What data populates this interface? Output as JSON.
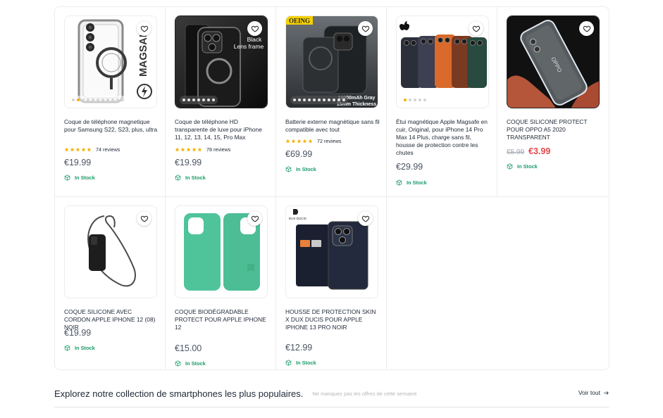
{
  "products": [
    {
      "title": "Coque de téléphone magnetique pour Samsung S22, S23, plus, ultra",
      "rating": 5,
      "reviews": "74 reviews",
      "price": "€19.99",
      "stock": "In Stock",
      "image_text": "MAGSAI",
      "dots": 11,
      "active_dot": 1
    },
    {
      "title": "Coque de téléphone HD transparente de luxe pour iPhone 11, 12, 13, 14, 15, Pro Max",
      "rating": 5,
      "reviews": "78 reviews",
      "price": "€19.99",
      "stock": "In Stock",
      "image_text_1": "Black",
      "image_text_2": "Lens frame",
      "dots": 7,
      "active_dot": 0
    },
    {
      "title": "Batterie externe magnétique sans fil compatible avec tout",
      "rating": 5,
      "reviews": "72 reviews",
      "price": "€69.99",
      "stock": "In Stock",
      "image_badge": "OEING",
      "image_text_1": "10000mAh Gray",
      "image_text_2": "15mm Thickness",
      "dots": 11,
      "active_dot": 0
    },
    {
      "title": "Étui magnétique Apple Magsafe en cuir, Original, pour iPhone 14 Pro Max 14 Plus, charge sans fil, housse de protection contre les chutes",
      "price": "€29.99",
      "stock": "In Stock",
      "dots": 5,
      "active_dot": 0
    },
    {
      "title": "COQUE SILICONE PROTECT POUR OPPO A5 2020 TRANSPARENT",
      "old_price": "€5.99",
      "price": "€3.99",
      "stock": "In Stock",
      "image_text": "OPPO"
    },
    {
      "title": "COQUE SILICONE AVEC CORDON APPLE IPHONE 12 (08) NOIR",
      "price": "€19.99",
      "stock": "In Stock"
    },
    {
      "title": "COQUE BIODÉGRADABLE PROTECT POUR APPLE IPHONE 12",
      "price": "€15.00",
      "stock": "In Stock"
    },
    {
      "title": "HOUSSE DE PROTECTION SKIN X DUX DUCIS POUR APPLE IPHONE 13 PRO NOIR",
      "price": "€12.99",
      "stock": "In Stock",
      "image_text": "DUX DUCIS"
    }
  ],
  "section": {
    "title": "Explorez notre collection de smartphones les plus populaires.",
    "subtitle": "Ne manquez pas les offres de cette semaine",
    "see_all": "Voir tout"
  },
  "colors": {
    "accent_green": "#1c9b6a",
    "sale_red": "#e5484d",
    "star": "#f5b301",
    "border": "#ececec"
  },
  "icons": [
    "heart-icon",
    "star-icon",
    "box-icon",
    "arrow-right-icon"
  ]
}
